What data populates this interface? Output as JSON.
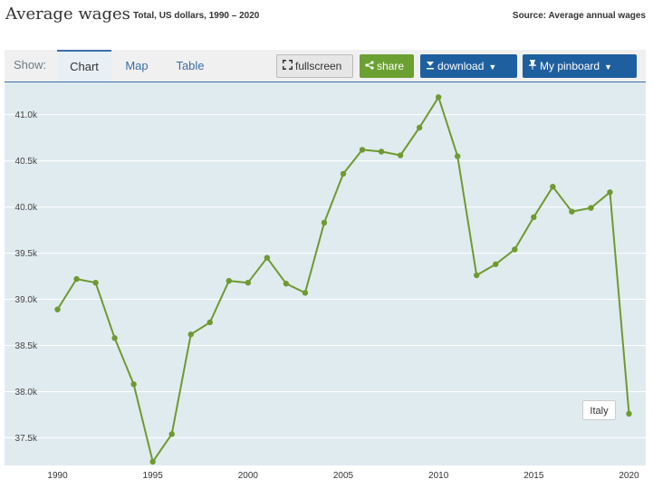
{
  "header": {
    "title": "Average wages",
    "subtitle": "Total, US dollars, 1990 – 2020",
    "source": "Source: Average annual wages"
  },
  "toolbar": {
    "show_label": "Show:",
    "tabs": [
      "Chart",
      "Map",
      "Table"
    ],
    "fullscreen_label": "fullscreen",
    "share_label": "share",
    "download_label": "download",
    "pinboard_label": "My pinboard"
  },
  "colors": {
    "line": "#6e9a2f",
    "plot_bg": "#e0ebf0",
    "accent": "#1e5f9f",
    "share": "#6ba032"
  },
  "chart_data": {
    "type": "line",
    "title": "Average wages",
    "subtitle": "Total, US dollars, 1990 – 2020",
    "xlabel": "",
    "ylabel": "",
    "xlim": [
      1989.5,
      2020.5
    ],
    "ylim": [
      37200,
      41350
    ],
    "y_ticks": [
      37500,
      38000,
      38500,
      39000,
      39500,
      40000,
      40500,
      41000
    ],
    "y_tick_labels": [
      "37.5k",
      "38.0k",
      "38.5k",
      "39.0k",
      "39.5k",
      "40.0k",
      "40.5k",
      "41.0k"
    ],
    "x_ticks": [
      1990,
      1995,
      2000,
      2005,
      2010,
      2015,
      2020
    ],
    "x_tick_labels": [
      "1990",
      "1995",
      "2000",
      "2005",
      "2010",
      "2015",
      "2020"
    ],
    "grid": true,
    "series": [
      {
        "name": "Italy",
        "x": [
          1990,
          1991,
          1992,
          1993,
          1994,
          1995,
          1996,
          1997,
          1998,
          1999,
          2000,
          2001,
          2002,
          2003,
          2004,
          2005,
          2006,
          2007,
          2008,
          2009,
          2010,
          2011,
          2012,
          2013,
          2014,
          2015,
          2016,
          2017,
          2018,
          2019,
          2020
        ],
        "values": [
          38890,
          39220,
          39180,
          38580,
          38080,
          37240,
          37540,
          38620,
          38750,
          39200,
          39180,
          39450,
          39170,
          39070,
          39830,
          40360,
          40620,
          40600,
          40560,
          40860,
          41190,
          40550,
          39260,
          39380,
          39540,
          39890,
          40220,
          39950,
          39990,
          40160,
          37760
        ]
      }
    ]
  }
}
